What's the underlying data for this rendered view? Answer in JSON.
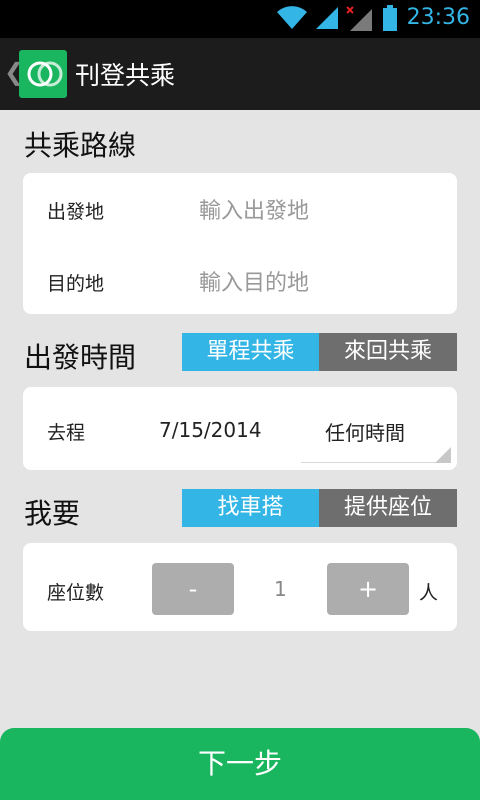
{
  "status_bar": {
    "time": "23:36",
    "icons": [
      "wifi-icon",
      "signal-icon",
      "signal-no-service-icon",
      "battery-icon"
    ]
  },
  "action_bar": {
    "title": "刊登共乘",
    "back_icon": "back-chevron-icon",
    "logo_icon": "app-logo-icon"
  },
  "route": {
    "title": "共乘路線",
    "origin_label": "出發地",
    "origin_placeholder": "輸入出發地",
    "destination_label": "目的地",
    "destination_placeholder": "輸入目的地"
  },
  "departure": {
    "title": "出發時間",
    "trip_toggle": [
      {
        "label": "單程共乘",
        "selected": true
      },
      {
        "label": "來回共乘",
        "selected": false
      }
    ],
    "leg_label": "去程",
    "date": "7/15/2014",
    "time": "任何時間"
  },
  "want": {
    "title": "我要",
    "role_toggle": [
      {
        "label": "找車搭",
        "selected": true
      },
      {
        "label": "提供座位",
        "selected": false
      }
    ],
    "seats_label": "座位數",
    "minus_label": "-",
    "seats_value": "1",
    "plus_label": "+",
    "unit": "人"
  },
  "footer": {
    "next_label": "下一步"
  },
  "colors": {
    "accent": "#33b5e5",
    "brand_green": "#1ab55f",
    "segment_inactive": "#6e6e6e",
    "background": "#e4e4e4"
  }
}
